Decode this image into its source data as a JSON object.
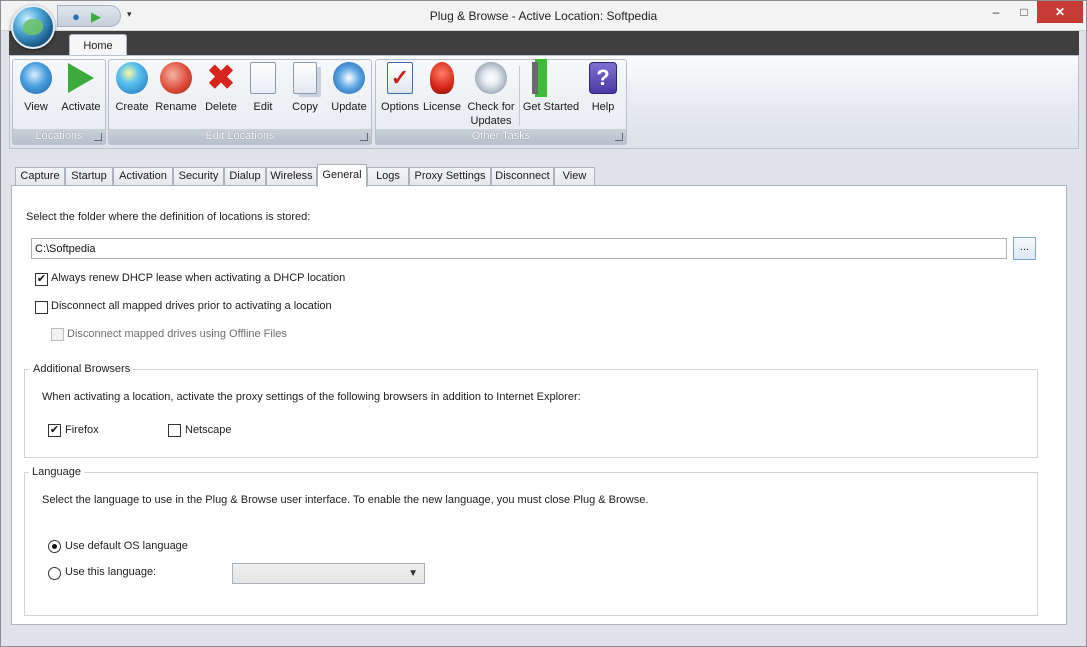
{
  "window": {
    "title": "Plug & Browse - Active Location: Softpedia",
    "controls": {
      "minimize": "–",
      "maximize": "□",
      "close": "✕"
    }
  },
  "quick_access": {
    "icons": [
      "view-icon",
      "activate-icon"
    ],
    "dropdown": "▾"
  },
  "ribbon": {
    "tabs": [
      {
        "label": "Home",
        "active": true
      }
    ],
    "groups": [
      {
        "caption": "Locations",
        "buttons": [
          "View",
          "Activate"
        ]
      },
      {
        "caption": "Edit Locations",
        "buttons": [
          "Create",
          "Rename",
          "Delete",
          "Edit",
          "Copy",
          "Update"
        ]
      },
      {
        "caption": "Other Tasks",
        "buttons": [
          "Options",
          "License",
          "Check for\nUpdates",
          "Get Started",
          "Help"
        ]
      }
    ],
    "labels": {
      "view": "View",
      "activate": "Activate",
      "create": "Create",
      "rename": "Rename",
      "delete": "Delete",
      "edit": "Edit",
      "copy": "Copy",
      "update": "Update",
      "options": "Options",
      "license": "License",
      "check1": "Check for",
      "check2": "Updates",
      "get_started": "Get Started",
      "help": "Help"
    },
    "captions": {
      "locations": "Locations",
      "edit_locations": "Edit Locations",
      "other_tasks": "Other Tasks"
    }
  },
  "tabs": {
    "items": [
      "Capture",
      "Startup",
      "Activation",
      "Security",
      "Dialup",
      "Wireless",
      "General",
      "Logs",
      "Proxy Settings",
      "Disconnect",
      "View"
    ],
    "active": "General"
  },
  "general": {
    "folder_prompt": "Select the folder where the definition of locations is stored:",
    "folder_value": "C:\\Softpedia",
    "browse_label": "...",
    "renew_dhcp": {
      "label": "Always renew DHCP lease when activating a DHCP location",
      "checked": true
    },
    "disconnect_drives": {
      "label": "Disconnect all mapped drives prior to activating a location",
      "checked": false
    },
    "disconnect_offline": {
      "label": "Disconnect mapped drives using Offline Files",
      "checked": false,
      "enabled": false
    },
    "browsers": {
      "title": "Additional Browsers",
      "description": "When activating a location, activate the proxy settings of the following browsers in addition to Internet Explorer:",
      "firefox": {
        "label": "Firefox",
        "checked": true
      },
      "netscape": {
        "label": "Netscape",
        "checked": false
      }
    },
    "language": {
      "title": "Language",
      "description": "Select the language to use in the Plug & Browse user interface. To enable the new language, you must close Plug & Browse.",
      "default_os": {
        "label": "Use default OS language",
        "selected": true
      },
      "use_this": {
        "label": "Use this language:",
        "selected": false
      },
      "selected_language": ""
    }
  },
  "check_mark": "✔"
}
